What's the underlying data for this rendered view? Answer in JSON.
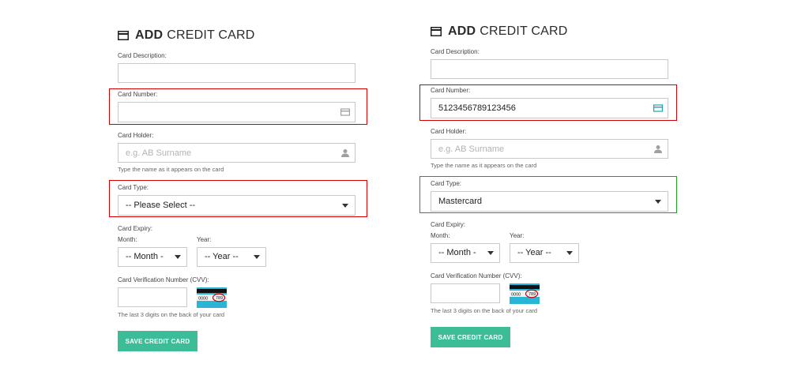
{
  "left": {
    "title_bold": "ADD",
    "title_rest": "CREDIT CARD",
    "description_label": "Card Description:",
    "description_value": "",
    "number_label": "Card Number:",
    "number_value": "",
    "holder_label": "Card Holder:",
    "holder_placeholder": "e.g. AB Surname",
    "holder_hint": "Type the name as it appears on the card",
    "type_label": "Card Type:",
    "type_value": "-- Please Select --",
    "expiry_label": "Card Expiry:",
    "month_label": "Month:",
    "month_value": "-- Month -",
    "year_label": "Year:",
    "year_value": "-- Year --",
    "cvv_label": "Card Verification Number (CVV):",
    "cvv_hint": "The last 3 digits on the back of your card",
    "cvv_card_digits": "0000",
    "cvv_card_code": "789",
    "save_label": "SAVE CREDIT CARD"
  },
  "right": {
    "title_bold": "ADD",
    "title_rest": "CREDIT CARD",
    "description_label": "Card Description:",
    "description_value": "",
    "number_label": "Card Number:",
    "number_value": "5123456789123456",
    "holder_label": "Card Holder:",
    "holder_placeholder": "e.g. AB Surname",
    "holder_hint": "Type the name as it appears on the card",
    "type_label": "Card Type:",
    "type_value": "Mastercard",
    "expiry_label": "Card Expiry:",
    "month_label": "Month:",
    "month_value": "-- Month -",
    "year_label": "Year:",
    "year_value": "-- Year --",
    "cvv_label": "Card Verification Number (CVV):",
    "cvv_hint": "The last 3 digits on the back of your card",
    "cvv_card_digits": "0000",
    "cvv_card_code": "789",
    "save_label": "SAVE CREDIT CARD"
  },
  "colors": {
    "error_highlight": "#d10000",
    "valid_highlight": "#19a319",
    "button": "#3cbd98",
    "card_icon_valid": "#1aa6b7"
  },
  "icons": {
    "title": "credit-card-icon",
    "number": "credit-card-icon",
    "holder": "user-icon",
    "select": "caret-down-icon",
    "cvv": "cvv-card-icon"
  }
}
